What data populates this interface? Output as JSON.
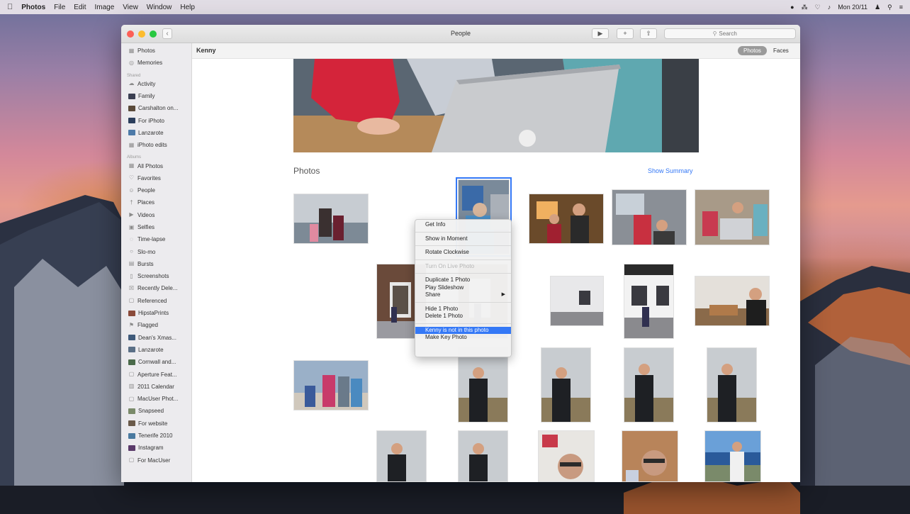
{
  "menubar": {
    "apple": "",
    "items": [
      "Photos",
      "File",
      "Edit",
      "Image",
      "View",
      "Window",
      "Help"
    ],
    "clock": "Mon 20/11"
  },
  "window": {
    "title": "People",
    "search_placeholder": "Search"
  },
  "sidebar": {
    "top": [
      {
        "label": "Photos",
        "icon": "grid-icon"
      },
      {
        "label": "Memories",
        "icon": "memories-icon"
      }
    ],
    "shared_heading": "Shared",
    "shared": [
      {
        "label": "Activity",
        "icon": "cloud-icon"
      },
      {
        "label": "Family",
        "icon": "album-thumb",
        "color": "#3b3f52"
      },
      {
        "label": "Carshalton on...",
        "icon": "album-thumb",
        "color": "#5a4a3a"
      },
      {
        "label": "For iPhoto",
        "icon": "album-thumb",
        "color": "#2b3e5c"
      },
      {
        "label": "Lanzarote",
        "icon": "album-thumb",
        "color": "#4d7aa8"
      },
      {
        "label": "iPhoto edits",
        "icon": "grid-icon"
      }
    ],
    "albums_heading": "Albums",
    "albums": [
      {
        "label": "All Photos",
        "icon": "grid-icon"
      },
      {
        "label": "Favorites",
        "icon": "heart-icon"
      },
      {
        "label": "People",
        "icon": "person-icon"
      },
      {
        "label": "Places",
        "icon": "pin-icon"
      },
      {
        "label": "Videos",
        "icon": "video-icon"
      },
      {
        "label": "Selfies",
        "icon": "camera-icon"
      },
      {
        "label": "Time-lapse",
        "icon": "timelapse-icon"
      },
      {
        "label": "Slo-mo",
        "icon": "slomo-icon"
      },
      {
        "label": "Bursts",
        "icon": "burst-icon"
      },
      {
        "label": "Screenshots",
        "icon": "screenshot-icon"
      },
      {
        "label": "Recently Dele...",
        "icon": "trash-icon"
      },
      {
        "label": "Referenced",
        "icon": "folder-icon"
      },
      {
        "label": "HipstaPrints",
        "icon": "album-thumb",
        "color": "#8a4a3a"
      },
      {
        "label": "Flagged",
        "icon": "flag-icon"
      },
      {
        "label": "Dean's Xmas...",
        "icon": "album-thumb",
        "color": "#3f5a7a"
      },
      {
        "label": "Lanzarote",
        "icon": "album-thumb",
        "color": "#5a6f86"
      },
      {
        "label": "Cornwall and...",
        "icon": "album-thumb",
        "color": "#4a6a4a"
      },
      {
        "label": "Aperture Feat...",
        "icon": "folder-icon"
      },
      {
        "label": "2011 Calendar",
        "icon": "calendar-icon"
      },
      {
        "label": "MacUser Phot...",
        "icon": "folder-icon"
      },
      {
        "label": "Snapseed",
        "icon": "album-thumb",
        "color": "#7a8a6a"
      },
      {
        "label": "For website",
        "icon": "album-thumb",
        "color": "#6a5a4a"
      },
      {
        "label": "Tenerife 2010",
        "icon": "album-thumb",
        "color": "#4a7aa0"
      },
      {
        "label": "Instagram",
        "icon": "album-thumb",
        "color": "#5a3a6a"
      },
      {
        "label": "For MacUser",
        "icon": "folder-icon"
      }
    ]
  },
  "header": {
    "title": "Kenny",
    "seg_photos": "Photos",
    "seg_faces": "Faces"
  },
  "section": {
    "title": "Photos",
    "show_summary": "Show Summary"
  },
  "context_menu": {
    "groups": [
      [
        {
          "label": "Get Info"
        }
      ],
      [
        {
          "label": "Show in Moment"
        }
      ],
      [
        {
          "label": "Rotate Clockwise"
        }
      ],
      [
        {
          "label": "Turn On Live Photo",
          "disabled": true
        }
      ],
      [
        {
          "label": "Duplicate 1 Photo"
        },
        {
          "label": "Play Slideshow"
        },
        {
          "label": "Share",
          "submenu": true
        }
      ],
      [
        {
          "label": "Hide 1 Photo"
        },
        {
          "label": "Delete 1 Photo"
        }
      ],
      [
        {
          "label": "Kenny is not in this photo",
          "highlighted": true
        },
        {
          "label": "Make Key Photo"
        }
      ]
    ]
  },
  "colors": {
    "accent": "#3478f6"
  }
}
